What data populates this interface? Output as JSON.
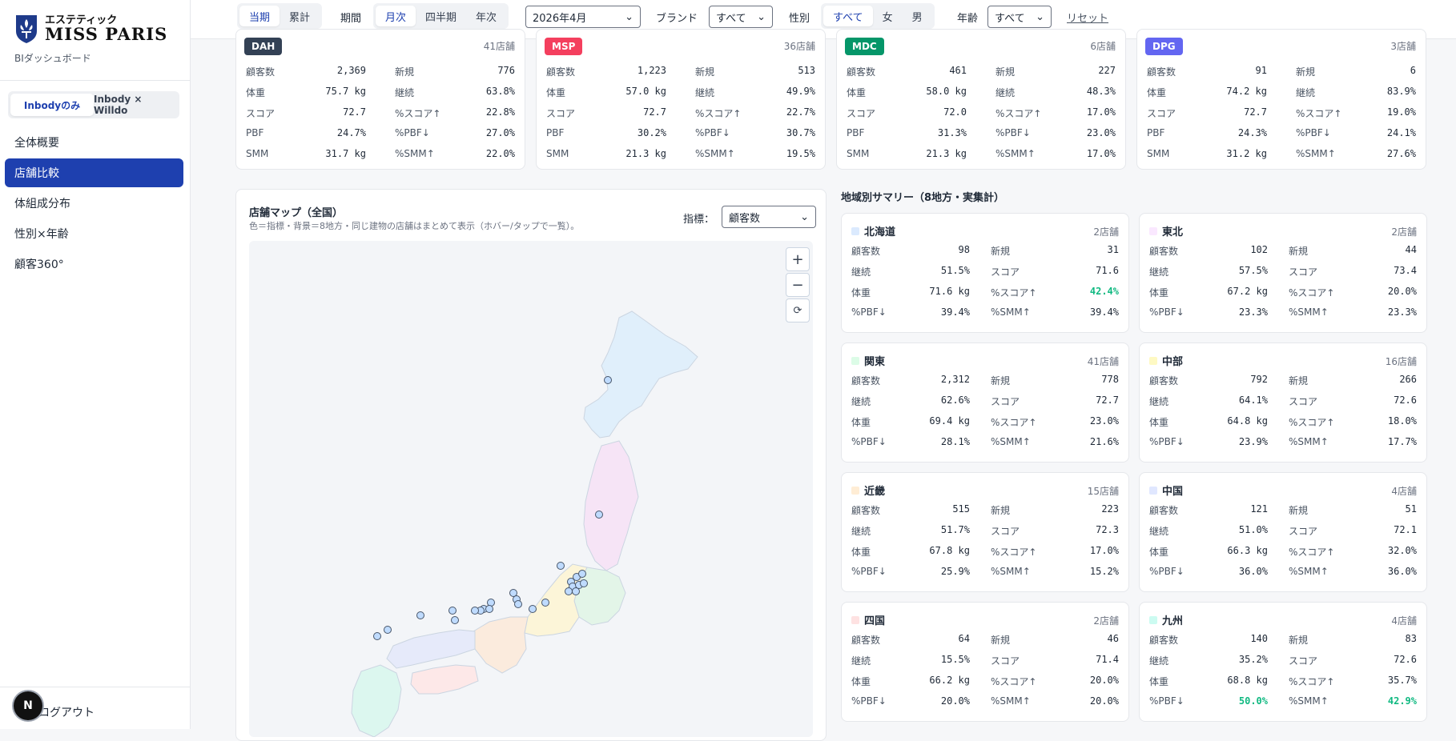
{
  "sidebar": {
    "logo_ja": "エステティック",
    "logo_en": "MISS PARIS",
    "subtitle": "BIダッシュボード",
    "data_toggle": [
      {
        "label": "Inbodyのみ",
        "active": true
      },
      {
        "label": "Inbody × Willdo",
        "active": false
      }
    ],
    "nav": [
      {
        "label": "全体概要",
        "active": false
      },
      {
        "label": "店舗比較",
        "active": true
      },
      {
        "label": "体組成分布",
        "active": false
      },
      {
        "label": "性別×年齢",
        "active": false
      },
      {
        "label": "顧客360°",
        "active": false
      }
    ],
    "logout": "ログアウト",
    "user_initial": "N"
  },
  "filters": {
    "scope": [
      {
        "label": "当期",
        "active": true
      },
      {
        "label": "累計",
        "active": false
      }
    ],
    "period_label": "期間",
    "period": [
      {
        "label": "月次",
        "active": true
      },
      {
        "label": "四半期",
        "active": false
      },
      {
        "label": "年次",
        "active": false
      }
    ],
    "month": "2026年4月",
    "brand_label": "ブランド",
    "brand": "すべて",
    "gender_label": "性別",
    "gender": [
      {
        "label": "すべて",
        "active": true
      },
      {
        "label": "女",
        "active": false
      },
      {
        "label": "男",
        "active": false
      }
    ],
    "age_label": "年齢",
    "age": "すべて",
    "reset": "リセット"
  },
  "brands": [
    {
      "code": "DAH",
      "color": "#334155",
      "stores": "41店舗",
      "rows": [
        [
          "顧客数",
          "2,369",
          "新規",
          "776"
        ],
        [
          "体重",
          "75.7 kg",
          "継続",
          "63.8%"
        ],
        [
          "スコア",
          "72.7",
          "%スコア↑",
          "22.8%"
        ],
        [
          "PBF",
          "24.7%",
          "%PBF↓",
          "27.0%"
        ],
        [
          "SMM",
          "31.7 kg",
          "%SMM↑",
          "22.0%"
        ]
      ]
    },
    {
      "code": "MSP",
      "color": "#f43f5e",
      "stores": "36店舗",
      "rows": [
        [
          "顧客数",
          "1,223",
          "新規",
          "513"
        ],
        [
          "体重",
          "57.0 kg",
          "継続",
          "49.9%"
        ],
        [
          "スコア",
          "72.7",
          "%スコア↑",
          "22.7%"
        ],
        [
          "PBF",
          "30.2%",
          "%PBF↓",
          "30.7%"
        ],
        [
          "SMM",
          "21.3 kg",
          "%SMM↑",
          "19.5%"
        ]
      ]
    },
    {
      "code": "MDC",
      "color": "#059669",
      "stores": "6店舗",
      "rows": [
        [
          "顧客数",
          "461",
          "新規",
          "227"
        ],
        [
          "体重",
          "58.0 kg",
          "継続",
          "48.3%"
        ],
        [
          "スコア",
          "72.0",
          "%スコア↑",
          "17.0%"
        ],
        [
          "PBF",
          "31.3%",
          "%PBF↓",
          "23.0%"
        ],
        [
          "SMM",
          "21.3 kg",
          "%SMM↑",
          "17.0%"
        ]
      ]
    },
    {
      "code": "DPG",
      "color": "#6366f1",
      "stores": "3店舗",
      "rows": [
        [
          "顧客数",
          "91",
          "新規",
          "6"
        ],
        [
          "体重",
          "74.2 kg",
          "継続",
          "83.9%"
        ],
        [
          "スコア",
          "72.7",
          "%スコア↑",
          "19.0%"
        ],
        [
          "PBF",
          "24.3%",
          "%PBF↓",
          "24.1%"
        ],
        [
          "SMM",
          "31.2 kg",
          "%SMM↑",
          "27.6%"
        ]
      ]
    }
  ],
  "map": {
    "title": "店舗マップ（全国）",
    "subtitle": "色＝指標・背景＝8地方・同じ建物の店舗はまとめて表示（ホバー/タップで一覧）。",
    "metric_label": "指標：",
    "metric": "顧客数",
    "zoom_in": "+",
    "zoom_out": "−",
    "reset": "⟳"
  },
  "regions_title": "地域別サマリー（8地方・実集計）",
  "regions": [
    {
      "name": "北海道",
      "swatch": "#dbeafe",
      "stores": "2店舗",
      "rows": [
        [
          "顧客数",
          "98",
          "新規",
          "31"
        ],
        [
          "継続",
          "51.5%",
          "スコア",
          "71.6"
        ],
        [
          "体重",
          "71.6 kg",
          "%スコア↑",
          "42.4%"
        ],
        [
          "%PBF↓",
          "39.4%",
          "%SMM↑",
          "39.4%"
        ]
      ],
      "hl": [
        [
          2,
          3
        ]
      ]
    },
    {
      "name": "東北",
      "swatch": "#fae8ff",
      "stores": "2店舗",
      "rows": [
        [
          "顧客数",
          "102",
          "新規",
          "44"
        ],
        [
          "継続",
          "57.5%",
          "スコア",
          "73.4"
        ],
        [
          "体重",
          "67.2 kg",
          "%スコア↑",
          "20.0%"
        ],
        [
          "%PBF↓",
          "23.3%",
          "%SMM↑",
          "23.3%"
        ]
      ],
      "hl": []
    },
    {
      "name": "関東",
      "swatch": "#dcfce7",
      "stores": "41店舗",
      "rows": [
        [
          "顧客数",
          "2,312",
          "新規",
          "778"
        ],
        [
          "継続",
          "62.6%",
          "スコア",
          "72.7"
        ],
        [
          "体重",
          "69.4 kg",
          "%スコア↑",
          "23.0%"
        ],
        [
          "%PBF↓",
          "28.1%",
          "%SMM↑",
          "21.6%"
        ]
      ],
      "hl": []
    },
    {
      "name": "中部",
      "swatch": "#fef9c3",
      "stores": "16店舗",
      "rows": [
        [
          "顧客数",
          "792",
          "新規",
          "266"
        ],
        [
          "継続",
          "64.1%",
          "スコア",
          "72.6"
        ],
        [
          "体重",
          "64.8 kg",
          "%スコア↑",
          "18.0%"
        ],
        [
          "%PBF↓",
          "23.9%",
          "%SMM↑",
          "17.7%"
        ]
      ],
      "hl": []
    },
    {
      "name": "近畿",
      "swatch": "#ffedd5",
      "stores": "15店舗",
      "rows": [
        [
          "顧客数",
          "515",
          "新規",
          "223"
        ],
        [
          "継続",
          "51.7%",
          "スコア",
          "72.3"
        ],
        [
          "体重",
          "67.8 kg",
          "%スコア↑",
          "17.0%"
        ],
        [
          "%PBF↓",
          "25.9%",
          "%SMM↑",
          "15.2%"
        ]
      ],
      "hl": []
    },
    {
      "name": "中国",
      "swatch": "#e0e7ff",
      "stores": "4店舗",
      "rows": [
        [
          "顧客数",
          "121",
          "新規",
          "51"
        ],
        [
          "継続",
          "51.0%",
          "スコア",
          "72.1"
        ],
        [
          "体重",
          "66.3 kg",
          "%スコア↑",
          "32.0%"
        ],
        [
          "%PBF↓",
          "36.0%",
          "%SMM↑",
          "36.0%"
        ]
      ],
      "hl": []
    },
    {
      "name": "四国",
      "swatch": "#fee2e2",
      "stores": "2店舗",
      "rows": [
        [
          "顧客数",
          "64",
          "新規",
          "46"
        ],
        [
          "継続",
          "15.5%",
          "スコア",
          "71.4"
        ],
        [
          "体重",
          "66.2 kg",
          "%スコア↑",
          "20.0%"
        ],
        [
          "%PBF↓",
          "20.0%",
          "%SMM↑",
          "20.0%"
        ]
      ],
      "hl": []
    },
    {
      "name": "九州",
      "swatch": "#ccfbf1",
      "stores": "4店舗",
      "rows": [
        [
          "顧客数",
          "140",
          "新規",
          "83"
        ],
        [
          "継続",
          "35.2%",
          "スコア",
          "72.6"
        ],
        [
          "体重",
          "68.8 kg",
          "%スコア↑",
          "35.7%"
        ],
        [
          "%PBF↓",
          "50.0%",
          "%SMM↑",
          "42.9%"
        ]
      ],
      "hl": [
        [
          3,
          1
        ],
        [
          3,
          3
        ]
      ]
    }
  ]
}
